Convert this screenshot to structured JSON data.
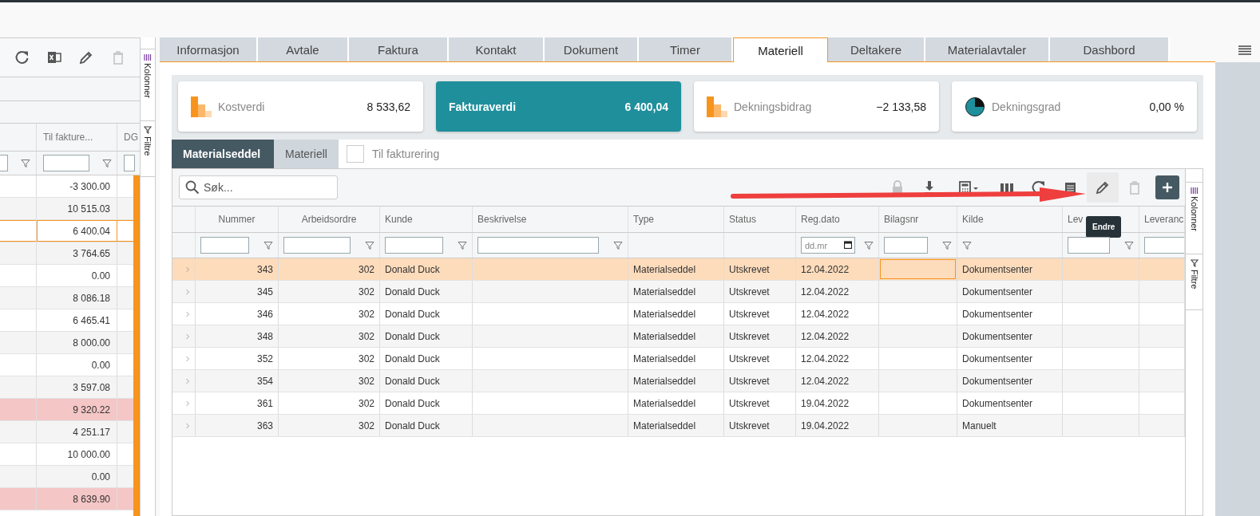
{
  "left_grid": {
    "toolbar": [
      {
        "kind": "refresh",
        "disabled": false
      },
      {
        "kind": "excel",
        "disabled": false
      },
      {
        "kind": "edit",
        "disabled": false
      },
      {
        "kind": "delete",
        "disabled": true
      }
    ],
    "columns": [
      "Til fakture...",
      "DG"
    ],
    "rows": [
      {
        "value": "-3 300.00",
        "selected": false,
        "flagged": false
      },
      {
        "value": "10 515.03",
        "selected": false,
        "flagged": false
      },
      {
        "value": "6 400.04",
        "selected": true,
        "flagged": false
      },
      {
        "value": "3 764.65",
        "selected": false,
        "flagged": false
      },
      {
        "value": "0.00",
        "selected": false,
        "flagged": false
      },
      {
        "value": "8 086.18",
        "selected": false,
        "flagged": false
      },
      {
        "value": "6 465.41",
        "selected": false,
        "flagged": false
      },
      {
        "value": "8 000.00",
        "selected": false,
        "flagged": false
      },
      {
        "value": "0.00",
        "selected": false,
        "flagged": false
      },
      {
        "value": "3 597.08",
        "selected": false,
        "flagged": false
      },
      {
        "value": "9 320.22",
        "selected": false,
        "flagged": true
      },
      {
        "value": "4 251.17",
        "selected": false,
        "flagged": false
      },
      {
        "value": "10 000.00",
        "selected": false,
        "flagged": false
      },
      {
        "value": "0.00",
        "selected": false,
        "flagged": false
      },
      {
        "value": "8 639.90",
        "selected": false,
        "flagged": true
      }
    ]
  },
  "left_side_tabs": [
    "Kolonner",
    "Filtre"
  ],
  "tabs": [
    {
      "label": "Informasjon",
      "selected": false
    },
    {
      "label": "Avtale",
      "selected": false
    },
    {
      "label": "Faktura",
      "selected": false
    },
    {
      "label": "Kontakt",
      "selected": false
    },
    {
      "label": "Dokument",
      "selected": false
    },
    {
      "label": "Timer",
      "selected": false
    },
    {
      "label": "Materiell",
      "selected": true
    },
    {
      "label": "Deltakere",
      "selected": false
    },
    {
      "label": "Materialavtaler",
      "selected": false
    },
    {
      "label": "Dashbord",
      "selected": false
    }
  ],
  "kpis": [
    {
      "label": "Kostverdi",
      "value": "8 533,62",
      "kind": "bars",
      "selected": false
    },
    {
      "label": "Fakturaverdi",
      "value": "6 400,04",
      "kind": "plain",
      "selected": true
    },
    {
      "label": "Dekningsbidrag",
      "value": "−2 133,58",
      "kind": "bars",
      "selected": false
    },
    {
      "label": "Dekningsgrad",
      "value": "0,00 %",
      "kind": "pie",
      "selected": false
    }
  ],
  "subtabs": [
    {
      "label": "Materialseddel",
      "selected": true
    },
    {
      "label": "Materiell",
      "selected": false
    }
  ],
  "invoice_filter": {
    "label": "Til fakturering",
    "checked": false
  },
  "grid": {
    "search": {
      "placeholder": "Søk..."
    },
    "toolbar": [
      {
        "kind": "lock",
        "disabled": true,
        "hovered": false
      },
      {
        "kind": "download",
        "disabled": false,
        "hovered": false
      },
      {
        "kind": "calculator",
        "disabled": false,
        "hovered": false
      },
      {
        "kind": "columns",
        "disabled": false,
        "hovered": false
      },
      {
        "kind": "refresh",
        "disabled": false,
        "hovered": false
      },
      {
        "kind": "sheet",
        "disabled": false,
        "hovered": false
      },
      {
        "kind": "edit",
        "disabled": false,
        "hovered": true
      },
      {
        "kind": "delete",
        "disabled": true,
        "hovered": false
      },
      {
        "kind": "add",
        "disabled": false,
        "hovered": false
      }
    ],
    "tooltip": "Endre",
    "columns": [
      {
        "kind": "expand"
      },
      {
        "label": "Nummer",
        "kind": "text"
      },
      {
        "label": "Arbeidsordre",
        "kind": "text"
      },
      {
        "label": "Kunde",
        "kind": "text"
      },
      {
        "label": "Beskrivelse",
        "kind": "text"
      },
      {
        "label": "Type",
        "kind": "plain"
      },
      {
        "label": "Status",
        "kind": "plain"
      },
      {
        "label": "Reg.dato",
        "kind": "date",
        "placeholder": "dd.mr"
      },
      {
        "label": "Bilagsnr",
        "kind": "text"
      },
      {
        "label": "Kilde",
        "kind": "button"
      },
      {
        "label": "Lev",
        "kind": "text"
      },
      {
        "label": "Leveranc",
        "kind": "input"
      }
    ],
    "rows": [
      {
        "selected": true,
        "cell_focused": true,
        "cells": [
          "",
          "343",
          "302",
          "Donald Duck",
          "",
          "Materialseddel",
          "Utskrevet",
          "12.04.2022",
          "",
          "Dokumentsenter"
        ]
      },
      {
        "selected": false,
        "cell_focused": false,
        "cells": [
          "",
          "345",
          "302",
          "Donald Duck",
          "",
          "Materialseddel",
          "Utskrevet",
          "12.04.2022",
          "",
          "Dokumentsenter"
        ]
      },
      {
        "selected": false,
        "cell_focused": false,
        "cells": [
          "",
          "346",
          "302",
          "Donald Duck",
          "",
          "Materialseddel",
          "Utskrevet",
          "12.04.2022",
          "",
          "Dokumentsenter"
        ]
      },
      {
        "selected": false,
        "cell_focused": false,
        "cells": [
          "",
          "348",
          "302",
          "Donald Duck",
          "",
          "Materialseddel",
          "Utskrevet",
          "12.04.2022",
          "",
          "Dokumentsenter"
        ]
      },
      {
        "selected": false,
        "cell_focused": false,
        "cells": [
          "",
          "352",
          "302",
          "Donald Duck",
          "",
          "Materialseddel",
          "Utskrevet",
          "12.04.2022",
          "",
          "Dokumentsenter"
        ]
      },
      {
        "selected": false,
        "cell_focused": false,
        "cells": [
          "",
          "354",
          "302",
          "Donald Duck",
          "",
          "Materialseddel",
          "Utskrevet",
          "12.04.2022",
          "",
          "Dokumentsenter"
        ]
      },
      {
        "selected": false,
        "cell_focused": false,
        "cells": [
          "",
          "361",
          "302",
          "Donald Duck",
          "",
          "Materialseddel",
          "Utskrevet",
          "19.04.2022",
          "",
          "Dokumentsenter"
        ]
      },
      {
        "selected": false,
        "cell_focused": false,
        "cells": [
          "",
          "363",
          "302",
          "Donald Duck",
          "",
          "Materialseddel",
          "Utskrevet",
          "19.04.2022",
          "",
          "Manuelt"
        ]
      }
    ],
    "side_tabs": [
      "Kolonner",
      "Filtre"
    ]
  }
}
